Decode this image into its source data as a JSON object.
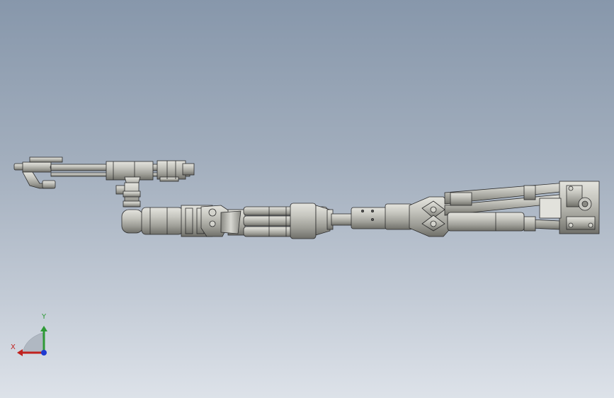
{
  "viewport": {
    "background_top": "#8797ab",
    "background_bottom": "#dde2e9",
    "model_fill": "#b9b9b3",
    "model_edge": "#2b2b2b"
  },
  "triad": {
    "x_label": "X",
    "y_label": "Y",
    "x_color": "#c0221f",
    "y_color": "#2e9a36",
    "z_color": "#1f3ad0"
  }
}
